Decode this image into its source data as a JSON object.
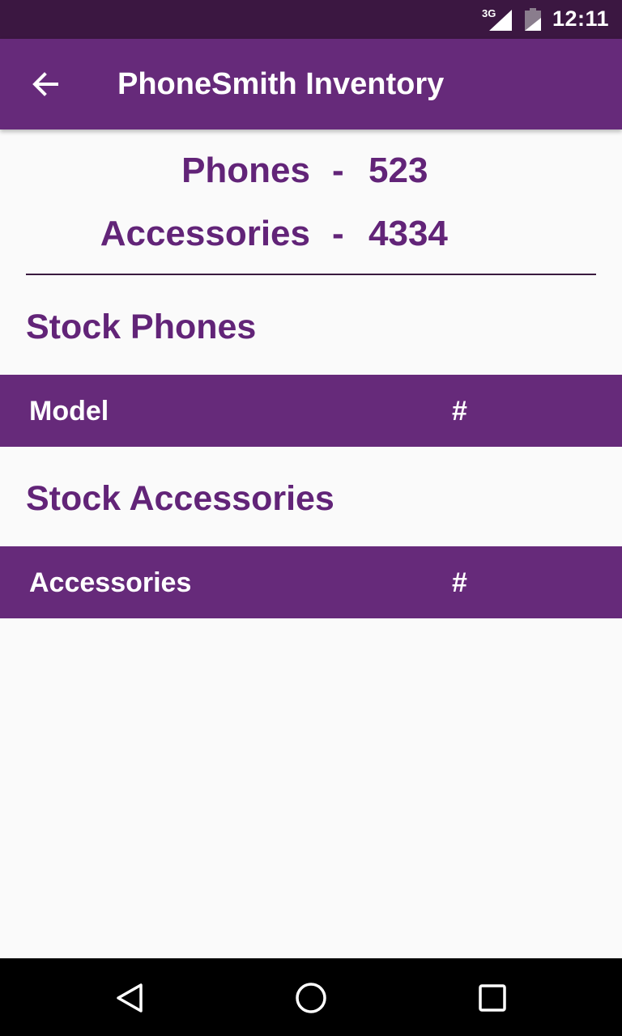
{
  "status_bar": {
    "network": "3G",
    "time": "12:11",
    "icons": [
      "signal-icon",
      "battery-icon"
    ]
  },
  "app_bar": {
    "title": "PhoneSmith Inventory",
    "back_icon": "back-arrow-icon"
  },
  "summary": {
    "phones": {
      "label": "Phones",
      "separator": "-",
      "count": "523"
    },
    "accessories": {
      "label": "Accessories",
      "separator": "-",
      "count": "4334"
    }
  },
  "stock_phones": {
    "title": "Stock Phones",
    "columns": [
      "Model",
      "#"
    ]
  },
  "stock_accessories": {
    "title": "Stock Accessories",
    "columns": [
      "Accessories",
      "#"
    ]
  },
  "nav_bar": {
    "icons": [
      "back-nav-icon",
      "home-nav-icon",
      "recents-nav-icon"
    ]
  },
  "colors": {
    "primary": "#662a7a",
    "primary_dark": "#3b1741",
    "text_accent": "#622478",
    "background": "#fafafa"
  }
}
